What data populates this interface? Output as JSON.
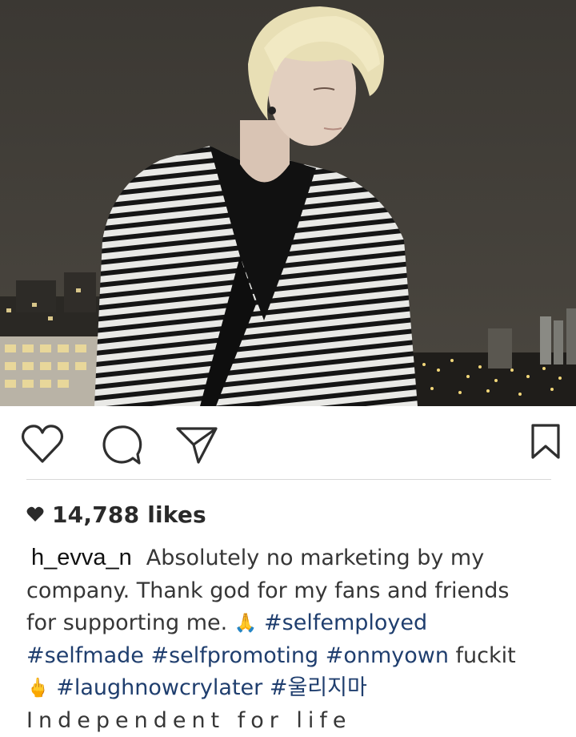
{
  "post": {
    "photo": {
      "subject": "Blond-haired person in a black-and-white striped cardigan over a black top",
      "background": "Night city skyline with lit apartment buildings"
    },
    "actions": {
      "like_icon": "heart-outline-icon",
      "comment_icon": "comment-bubble-icon",
      "share_icon": "paper-plane-icon",
      "save_icon": "bookmark-icon"
    },
    "likes": {
      "icon": "heart-filled-icon",
      "text": "14,788 likes"
    },
    "caption": {
      "username": "h_evva_n",
      "line1": "Absolutely no marketing by my",
      "line2": "company. Thank god for my fans and friends",
      "line3_text": "for supporting me.",
      "line3_emoji": "🙏",
      "line3_tag": "#selfemployed",
      "line4_tags": "#selfmade #selfpromoting #onmyown",
      "line4_text": "fuckit",
      "line5_emoji": "🖕",
      "line5_tags": "#laughnowcrylater #울리지마",
      "line6": "Independent for life"
    },
    "colors": {
      "hashtag": "#1f3e6e",
      "text": "#363636",
      "divider": "#d9d9d9"
    }
  }
}
